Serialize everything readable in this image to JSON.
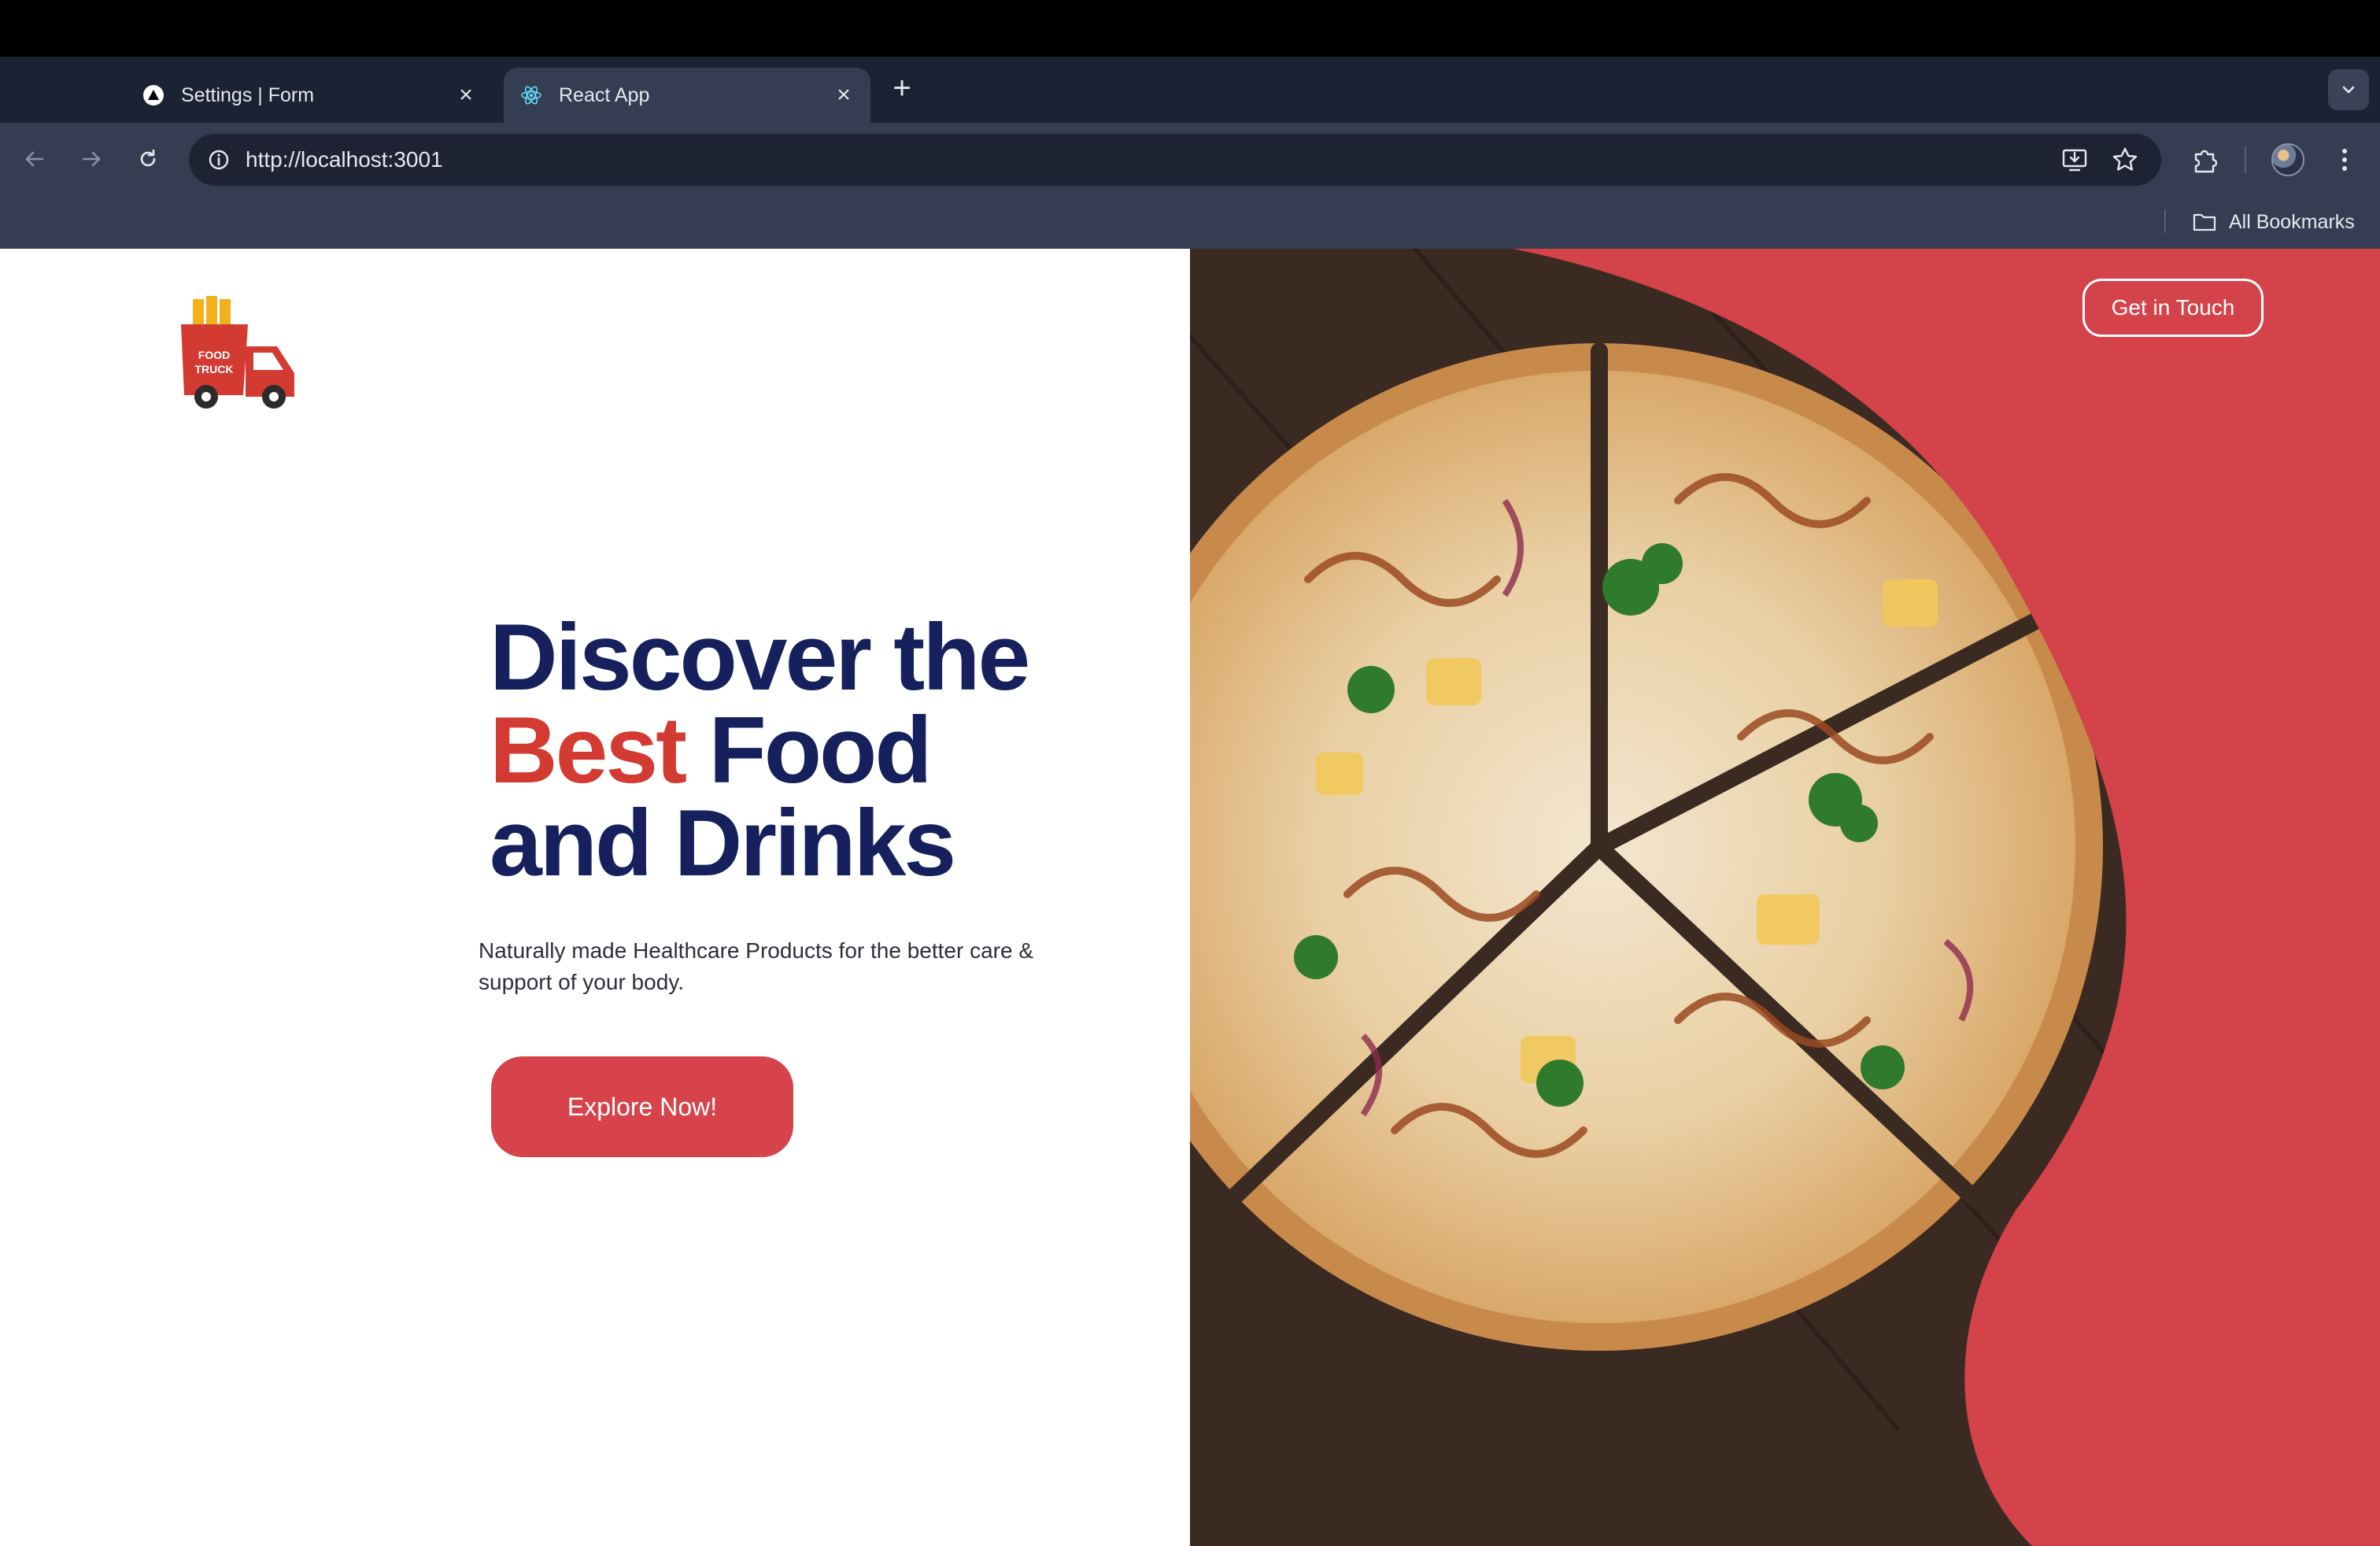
{
  "browser": {
    "tabs": [
      {
        "title": "Settings | Form",
        "icon": "vercel-triangle-icon",
        "active": false
      },
      {
        "title": "React App",
        "icon": "react-logo-icon",
        "active": true
      }
    ],
    "url": "http://localhost:3001",
    "bookmarks_label": "All Bookmarks"
  },
  "site": {
    "logo_text": "FOOD TRUCK",
    "nav": {
      "contact_label": "Get in Touch"
    },
    "hero": {
      "line1": "Discover the",
      "accent_word": "Best",
      "line2_rest": " Food",
      "line3": "and Drinks",
      "subtitle": "Naturally made Healthcare Products for the better care & support of your body.",
      "cta_label": "Explore Now!"
    },
    "colors": {
      "brand_red": "#d6434b",
      "navy": "#15205c",
      "accent_red": "#d33a32"
    }
  }
}
